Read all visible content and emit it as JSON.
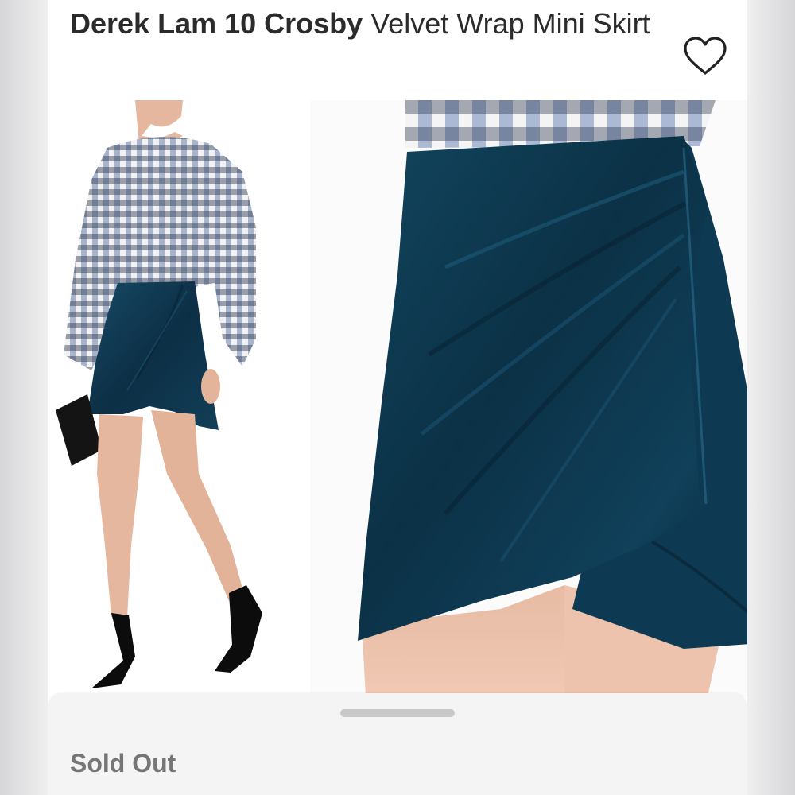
{
  "listing": {
    "brand": "Derek Lam 10 Crosby",
    "name": " Velvet Wrap Mini Skirt"
  },
  "status": {
    "label": "Sold Out"
  },
  "icons": {
    "like": "heart-icon"
  },
  "colors": {
    "velvet": "#0f3a52",
    "sheet": "#f4f4f5",
    "sold_out_text": "#767677"
  }
}
